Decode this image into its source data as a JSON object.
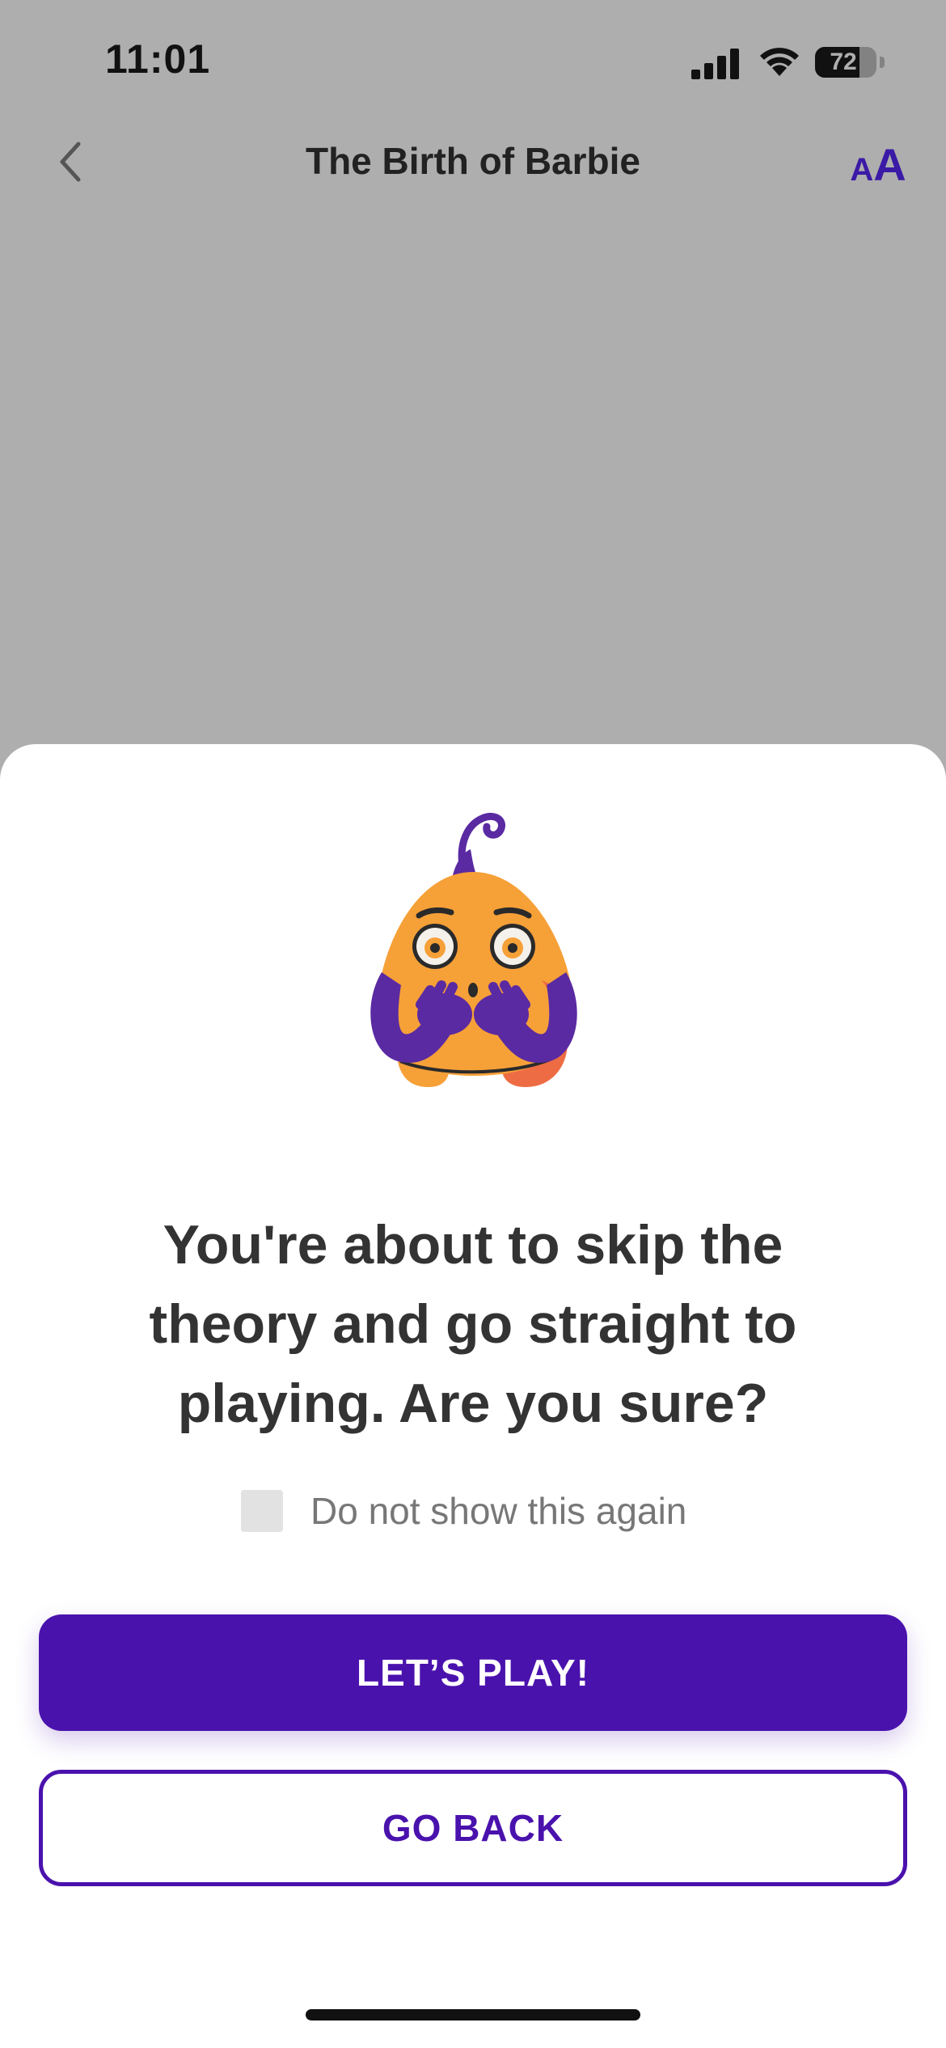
{
  "status_bar": {
    "time": "11:01",
    "battery_percent": "72",
    "battery_level": 0.72
  },
  "nav": {
    "title": "The Birth of Barbie",
    "font_size_small": "A",
    "font_size_big": "A"
  },
  "colors": {
    "accent": "#4a12ad",
    "mascot_body": "#f6a038",
    "mascot_arms": "#5a2aa2",
    "overlay": "#aeaeae"
  },
  "icons": {
    "back": "chevron-left-icon",
    "font": "font-size-icon",
    "signal": "cellular-signal-icon",
    "wifi": "wifi-icon",
    "battery": "battery-icon",
    "mascot": "shocked-mascot-illustration"
  },
  "dialog": {
    "message": "You're about to skip the theory and go straight to playing. Are you sure?",
    "checkbox_label": "Do not show this again",
    "checkbox_checked": false,
    "primary_button": "LET’S PLAY!",
    "secondary_button": "GO BACK"
  }
}
